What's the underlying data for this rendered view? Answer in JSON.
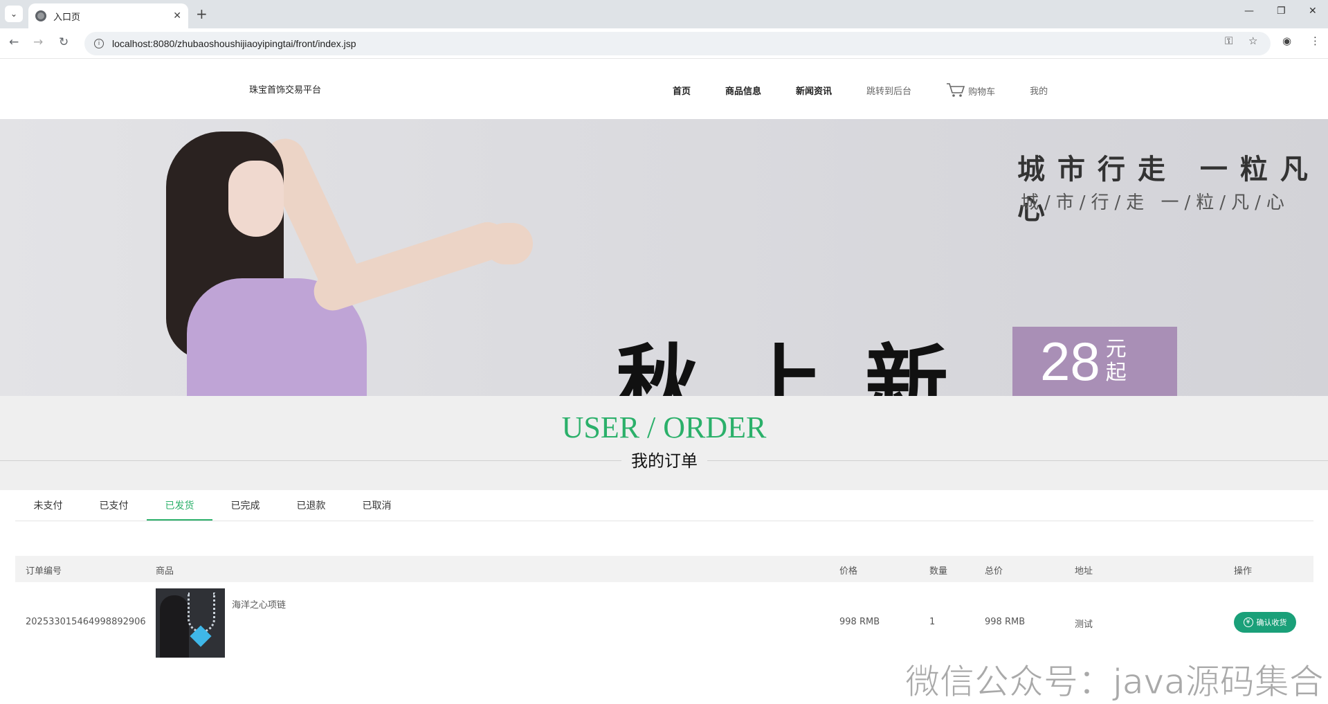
{
  "browser": {
    "tab_title": "入口页",
    "url": "localhost:8080/zhubaoshoushijiaoyipingtai/front/index.jsp"
  },
  "site": {
    "brand": "珠宝首饰交易平台",
    "nav": {
      "home": "首页",
      "products": "商品信息",
      "news": "新闻资讯",
      "admin": "跳转到后台",
      "cart": "购物车",
      "mine": "我的"
    }
  },
  "banner": {
    "slogan_top": "城市行走  一粒凡心",
    "slogan_sub": "城/市/行/走   一/粒/凡/心",
    "headline": "秋上新",
    "price": "28",
    "price_unit": "元起"
  },
  "section": {
    "en_title": "USER / ORDER",
    "cn_title": "我的订单"
  },
  "order_tabs": [
    {
      "label": "未支付"
    },
    {
      "label": "已支付"
    },
    {
      "label": "已发货",
      "active": true
    },
    {
      "label": "已完成"
    },
    {
      "label": "已退款"
    },
    {
      "label": "已取消"
    }
  ],
  "table": {
    "headers": {
      "order_no": "订单编号",
      "product": "商品",
      "price": "价格",
      "qty": "数量",
      "total": "总价",
      "address": "地址",
      "action": "操作"
    },
    "rows": [
      {
        "order_no": "20253301546499889​2906",
        "product_name": "海洋之心项链",
        "price": "998 RMB",
        "qty": "1",
        "total": "998 RMB",
        "address": "测试",
        "action": "确认收货"
      }
    ]
  },
  "watermark": "微信公众号：java源码集合",
  "colors": {
    "accent": "#2bb06a",
    "button": "#1aa079"
  }
}
